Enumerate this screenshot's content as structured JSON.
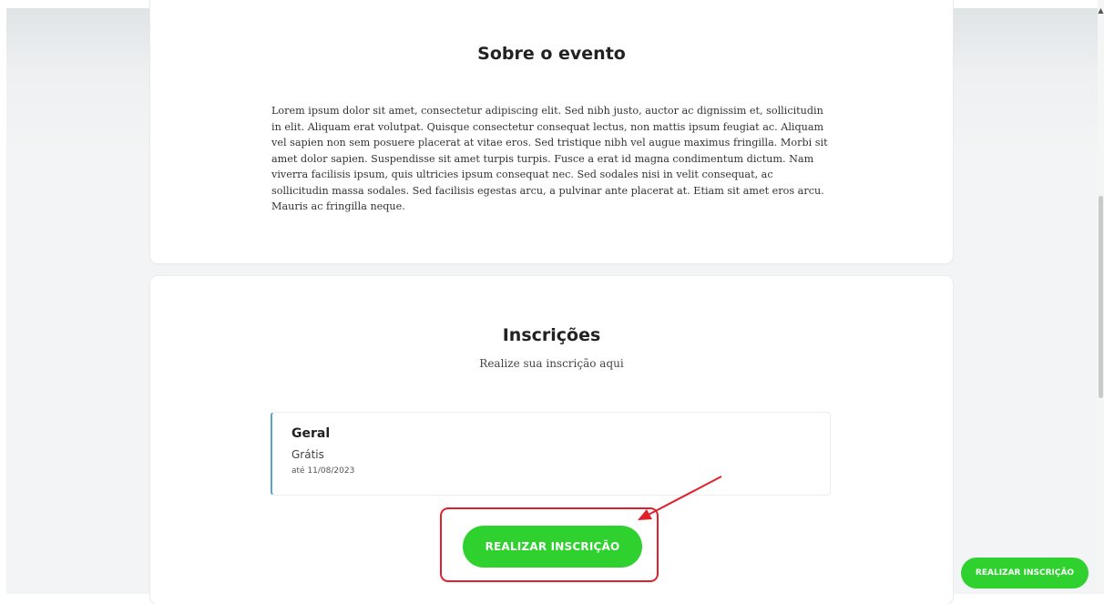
{
  "about": {
    "title": "Sobre o evento",
    "text": "Lorem ipsum dolor sit amet, consectetur adipiscing elit. Sed nibh justo, auctor ac dignissim et, sollicitudin in elit. Aliquam erat volutpat. Quisque consectetur consequat lectus, non mattis ipsum feugiat ac. Aliquam vel sapien non sem posuere placerat at vitae eros. Sed tristique nibh vel augue maximus fringilla. Morbi sit amet dolor sapien. Suspendisse sit amet turpis turpis. Fusce a erat id magna condimentum dictum. Nam viverra facilisis ipsum, quis ultricies ipsum consequat nec. Sed sodales nisi in velit consequat, ac sollicitudin massa sodales. Sed facilisis egestas arcu, a pulvinar ante placerat at. Etiam sit amet eros arcu. Mauris ac fringilla neque."
  },
  "registration": {
    "title": "Inscrições",
    "subtitle": "Realize sua inscrição aqui",
    "ticket": {
      "name": "Geral",
      "price": "Grátis",
      "deadline": "até 11/08/2023"
    },
    "button_label": "REALIZAR INSCRIÇÃO"
  },
  "floating_button": {
    "label": "REALIZAR INSCRIÇÃO"
  },
  "colors": {
    "accent_green": "#2ed12e",
    "annotation_red": "#e0202a",
    "ticket_border": "#5aa6c8"
  },
  "icons": {
    "scroll_up": "caret-up-icon",
    "annotation": "arrow-icon"
  }
}
